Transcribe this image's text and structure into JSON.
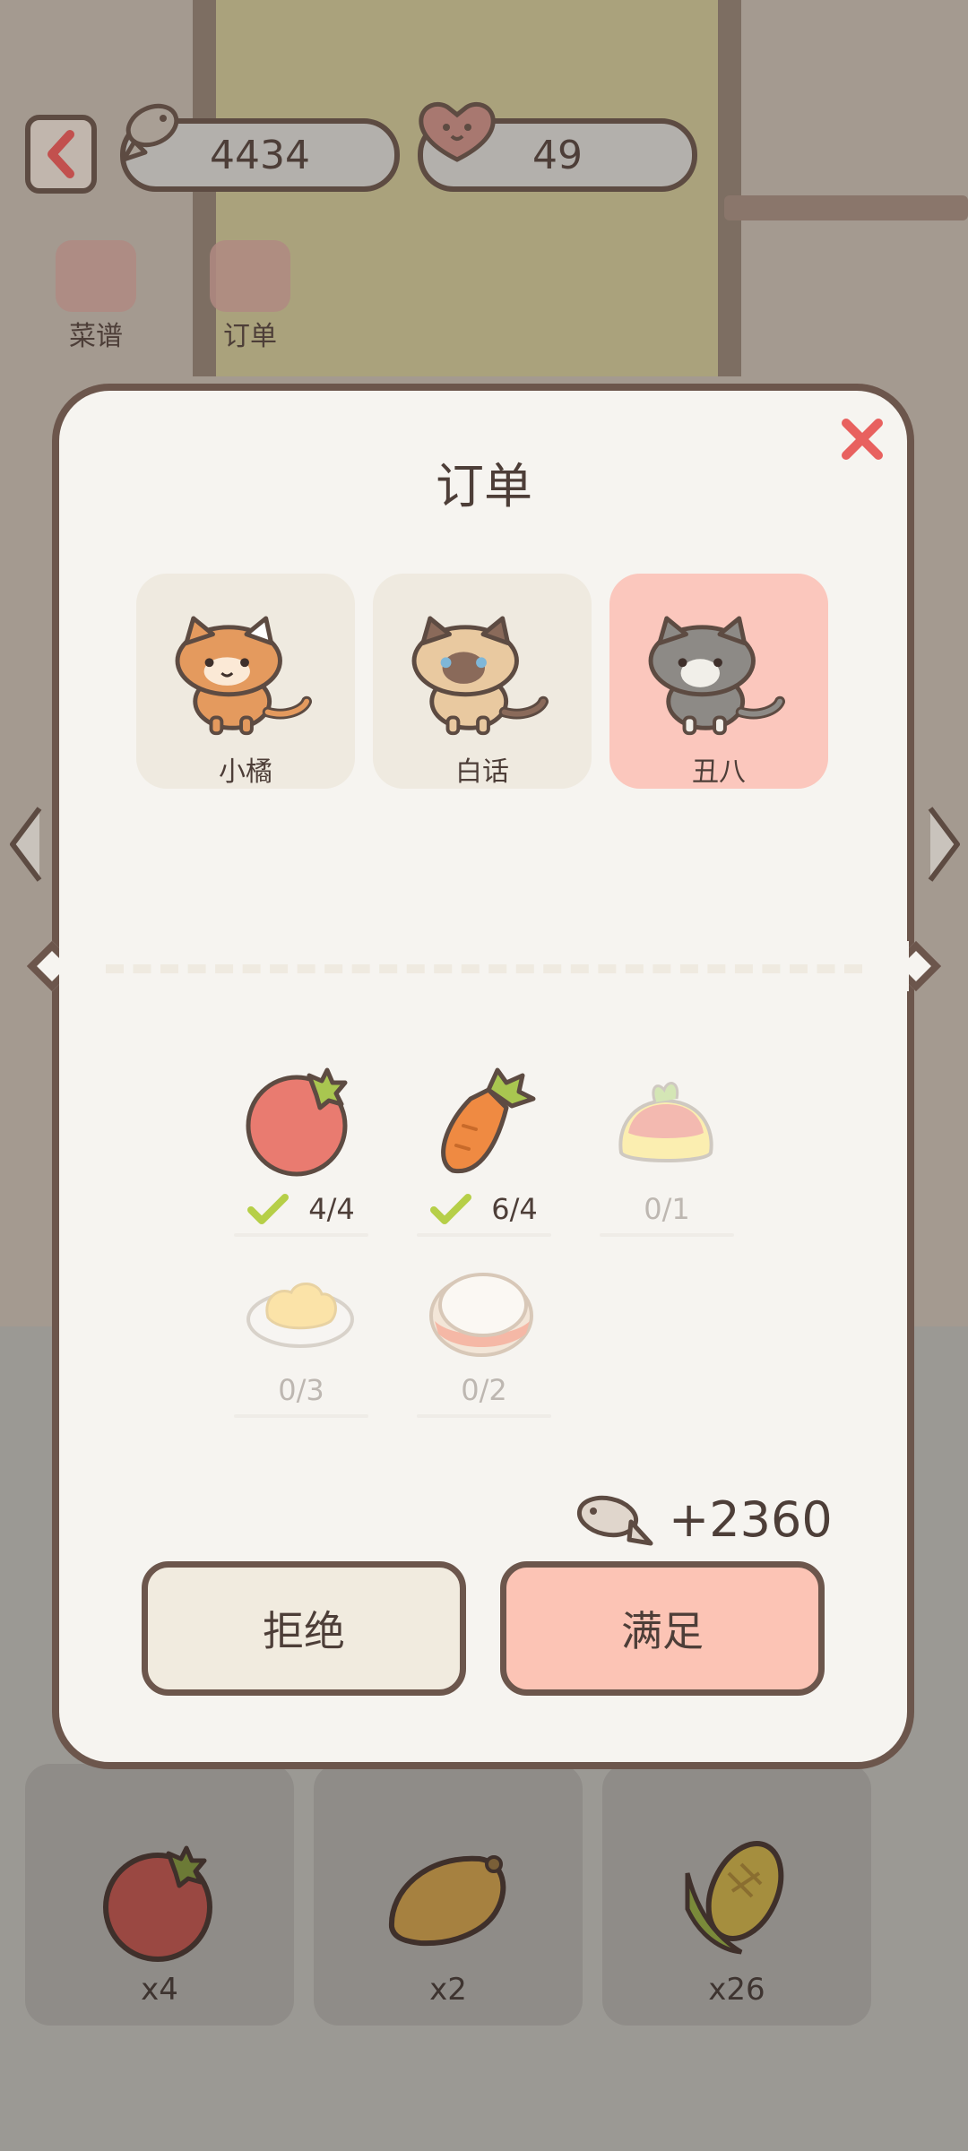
{
  "topbar": {
    "fish_count": "4434",
    "heart_count": "49"
  },
  "nav": {
    "recipes_label": "菜谱",
    "orders_label": "订单"
  },
  "modal": {
    "title": "订单",
    "cats": [
      {
        "name": "小橘",
        "selected": false
      },
      {
        "name": "白话",
        "selected": false
      },
      {
        "name": "丑八",
        "selected": true
      }
    ],
    "items": [
      {
        "icon": "tomato-icon",
        "progress": "4/4",
        "done": true
      },
      {
        "icon": "carrot-icon",
        "progress": "6/4",
        "done": true
      },
      {
        "icon": "pudding-icon",
        "progress": "0/1",
        "done": false
      },
      {
        "icon": "scrambled-egg-icon",
        "progress": "0/3",
        "done": false
      },
      {
        "icon": "sandwich-icon",
        "progress": "0/2",
        "done": false
      }
    ],
    "reward": "+2360",
    "reject_label": "拒绝",
    "accept_label": "满足"
  },
  "inventory": [
    {
      "icon": "tomato-icon",
      "count": "x4"
    },
    {
      "icon": "mango-icon",
      "count": "x2"
    },
    {
      "icon": "corn-icon",
      "count": "x26"
    }
  ],
  "colors": {
    "accent_close": "#e8615f",
    "check_green": "#b6cf48",
    "selected_card": "#fbc7bd",
    "outline": "#6c564c"
  }
}
